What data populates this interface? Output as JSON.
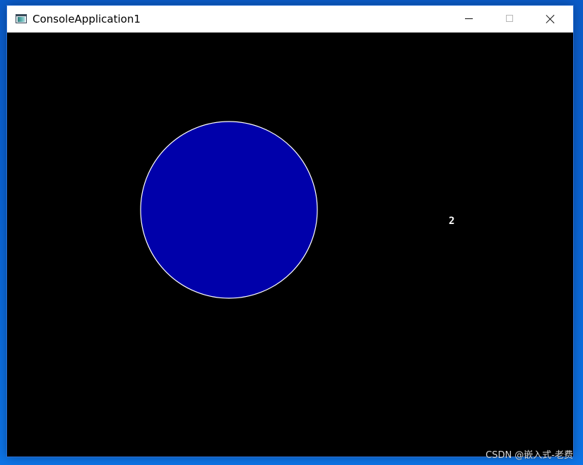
{
  "window": {
    "title": "ConsoleApplication1",
    "icon": "console-app-icon",
    "controls": {
      "minimize_icon": "minimize-icon",
      "maximize_icon": "maximize-icon",
      "close_icon": "close-icon"
    }
  },
  "canvas": {
    "background": "#000000",
    "circle": {
      "fill": "#0000aa",
      "stroke": "#ffffff"
    },
    "counter_text": "2"
  },
  "watermark": {
    "text": "CSDN @嵌入式-老费"
  }
}
